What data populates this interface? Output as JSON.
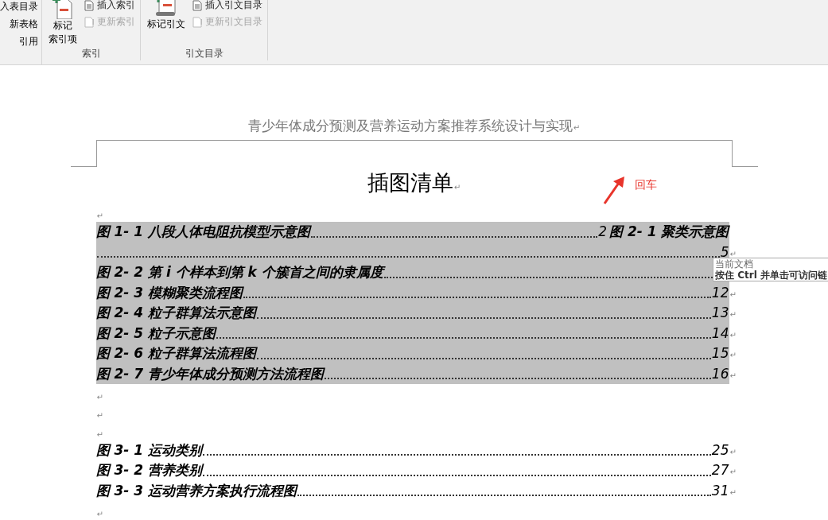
{
  "ribbon": {
    "partial_column": [
      "入表目录",
      "新表格",
      "引用"
    ],
    "groups": [
      {
        "label": "索引",
        "big_button": {
          "label_lines": [
            "标记",
            "索引项"
          ],
          "kind": "index"
        },
        "small_buttons": [
          {
            "label": "插入索引",
            "disabled": false
          },
          {
            "label": "更新索引",
            "disabled": true
          }
        ]
      },
      {
        "label": "引文目录",
        "big_button": {
          "label_lines": [
            "标记引文"
          ],
          "kind": "citation"
        },
        "small_buttons": [
          {
            "label": "插入引文目录",
            "disabled": false
          },
          {
            "label": "更新引文目录",
            "disabled": true
          }
        ]
      }
    ]
  },
  "document": {
    "header": {
      "text": "青少年体成分预测及营养运动方案推荐系统设计与实现",
      "mark": "↵"
    },
    "title": {
      "text": "插图清单",
      "mark": "↵"
    },
    "annotation": {
      "text": "回车"
    },
    "blocks": [
      {
        "kind": "empty",
        "mark": "↵"
      },
      {
        "kind": "toc",
        "highlighted": true,
        "paragraphs": [
          {
            "kind": "merged",
            "entries": [
              {
                "title": "图 1- 1 八段人体电阻抗模型示意图",
                "page": "2"
              },
              {
                "title": "图 2- 1 聚类示意图",
                "page": "5"
              }
            ],
            "mark": "↵"
          },
          {
            "kind": "entry",
            "title": "图 2- 2 第 i 个样本到第 k 个簇首之间的隶属度"
          },
          {
            "kind": "entry",
            "title": "图 2- 3 模糊聚类流程图",
            "page": "12",
            "mark": "↵"
          },
          {
            "kind": "entry",
            "title": "图 2- 4 粒子群算法示意图",
            "page": "13",
            "mark": "↵"
          },
          {
            "kind": "entry",
            "title": "图 2- 5 粒子示意图",
            "page": "14",
            "mark": "↵"
          },
          {
            "kind": "entry",
            "title": "图 2- 6 粒子群算法流程图",
            "page": "15",
            "mark": "↵"
          },
          {
            "kind": "entry",
            "title": "图 2- 7 青少年体成分预测方法流程图",
            "page": "16",
            "mark": "↵"
          }
        ]
      },
      {
        "kind": "empty",
        "mark": "↵"
      },
      {
        "kind": "empty",
        "mark": "↵"
      },
      {
        "kind": "empty",
        "mark": "↵"
      },
      {
        "kind": "toc",
        "highlighted": false,
        "paragraphs": [
          {
            "kind": "entry",
            "title": "图 3- 1 运动类别",
            "page": "25",
            "mark": "↵"
          },
          {
            "kind": "entry",
            "title": "图 3- 2 营养类别",
            "page": "27",
            "mark": "↵"
          },
          {
            "kind": "entry",
            "title": "图 3- 3 运动营养方案执行流程图",
            "page": "31",
            "mark": "↵"
          }
        ]
      },
      {
        "kind": "empty",
        "mark": "↵"
      }
    ]
  },
  "tooltip": {
    "lines": [
      "当前文档",
      "按住 Ctrl 并单击可访问链"
    ]
  }
}
